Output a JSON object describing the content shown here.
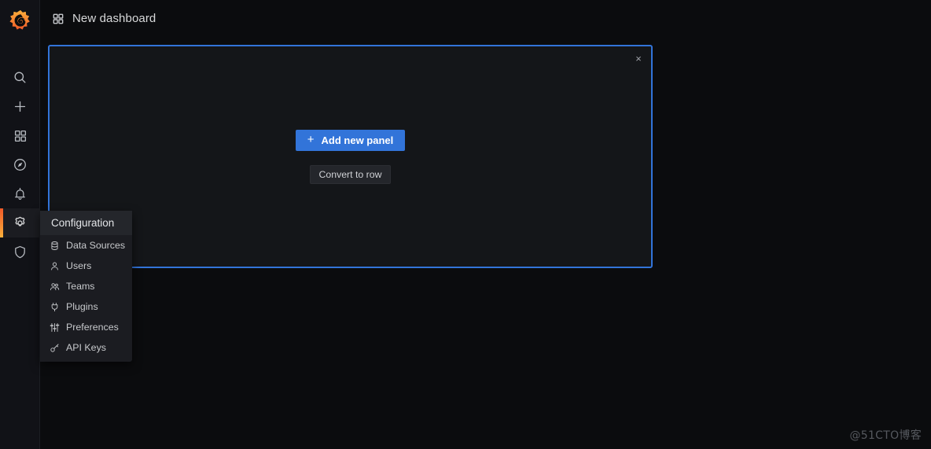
{
  "app": {
    "logo_icon": "grafana-logo-icon",
    "background_color": "#0b0c0e",
    "sidebar_color": "#111217",
    "accent_color": "#3274d9",
    "brand_gradient_start": "#f05a28",
    "brand_gradient_end": "#fbb03b"
  },
  "topbar": {
    "dashboard_icon": "apps-grid-icon",
    "title": "New dashboard"
  },
  "sidebar": {
    "items": [
      {
        "name": "search",
        "icon": "search-icon",
        "active": false
      },
      {
        "name": "create",
        "icon": "plus-icon",
        "active": false
      },
      {
        "name": "dashboards",
        "icon": "apps-grid-icon",
        "active": false
      },
      {
        "name": "explore",
        "icon": "compass-icon",
        "active": false
      },
      {
        "name": "alerting",
        "icon": "bell-icon",
        "active": false
      },
      {
        "name": "configuration",
        "icon": "gear-icon",
        "active": true
      },
      {
        "name": "server-admin",
        "icon": "shield-icon",
        "active": false
      }
    ]
  },
  "config_menu": {
    "header": "Configuration",
    "items": [
      {
        "label": "Data Sources",
        "icon": "database-icon"
      },
      {
        "label": "Users",
        "icon": "user-icon"
      },
      {
        "label": "Teams",
        "icon": "users-icon"
      },
      {
        "label": "Plugins",
        "icon": "plug-icon"
      },
      {
        "label": "Preferences",
        "icon": "sliders-icon"
      },
      {
        "label": "API Keys",
        "icon": "key-icon"
      }
    ]
  },
  "add_panel_widget": {
    "close_icon": "close-icon",
    "close_glyph": "×",
    "add_panel_label": "Add new panel",
    "add_panel_plus": "+",
    "convert_to_row_label": "Convert to row"
  },
  "watermark": {
    "text": "@51CTO博客"
  }
}
